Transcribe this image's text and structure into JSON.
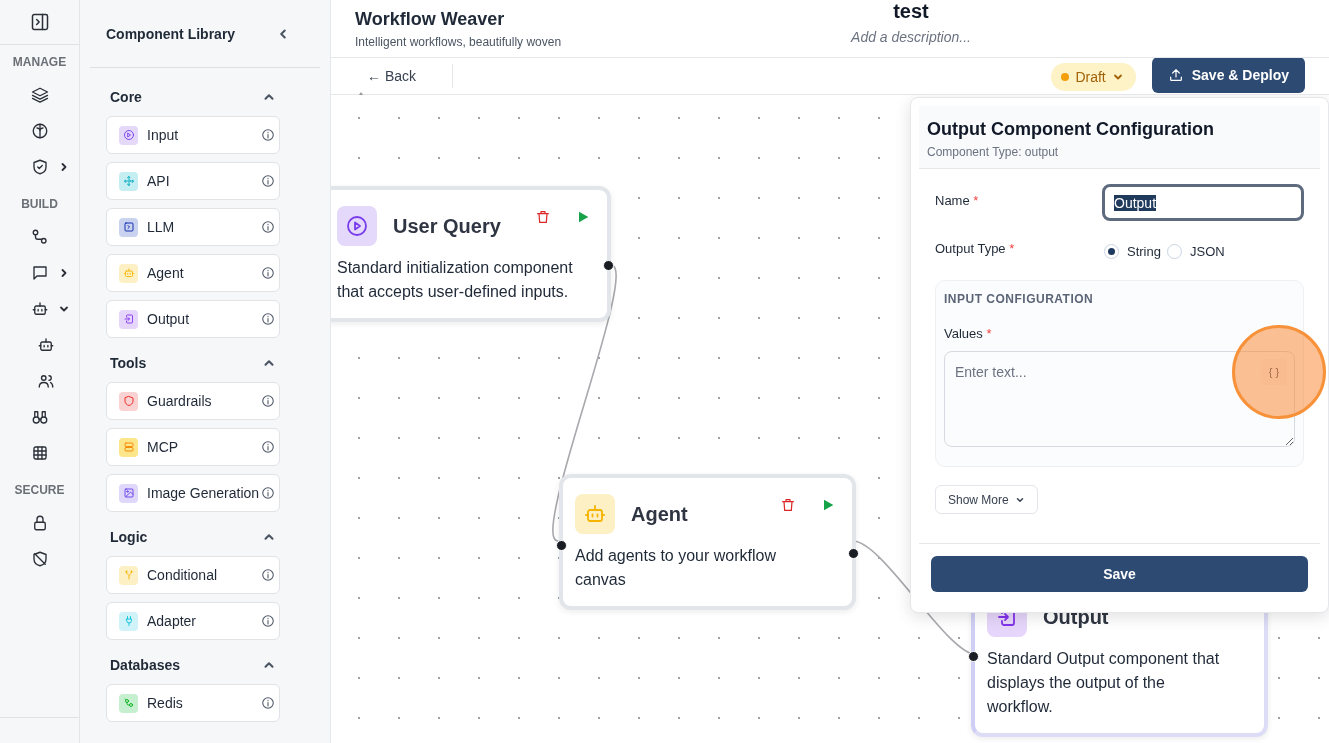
{
  "rail": {
    "sections": [
      {
        "label": "MANAGE",
        "items": [
          {
            "kind": "layers"
          },
          {
            "kind": "brain"
          },
          {
            "kind": "shield",
            "expanded": false
          }
        ]
      },
      {
        "label": "BUILD",
        "items": [
          {
            "kind": "flow"
          },
          {
            "kind": "chat",
            "expanded": false
          },
          {
            "kind": "bot",
            "expanded": true,
            "children": [
              {
                "kind": "bot"
              },
              {
                "kind": "users"
              }
            ]
          },
          {
            "kind": "binoculars"
          },
          {
            "kind": "grid"
          }
        ]
      },
      {
        "label": "SECURE",
        "items": [
          {
            "kind": "lock"
          },
          {
            "kind": "shieldoff"
          }
        ]
      }
    ]
  },
  "library": {
    "title": "Component Library",
    "sections": [
      {
        "title": "Core",
        "expanded": true,
        "items": [
          {
            "label": "Input",
            "kind": "play",
            "color": "#e4d8fb"
          },
          {
            "label": "API",
            "kind": "api",
            "color": "#c4eef2"
          },
          {
            "label": "LLM",
            "kind": "terminal",
            "color": "#c9d2ee"
          },
          {
            "label": "Agent",
            "kind": "bot",
            "color": "#fdf0c4"
          },
          {
            "label": "Output",
            "kind": "output",
            "color": "#e6d6fb"
          }
        ]
      },
      {
        "title": "Tools",
        "expanded": true,
        "items": [
          {
            "label": "Guardrails",
            "kind": "guard",
            "color": "#fbd2d2"
          },
          {
            "label": "MCP",
            "kind": "db",
            "color": "#fde68a"
          },
          {
            "label": "Image Generation",
            "kind": "image",
            "color": "#e0d8fb"
          }
        ]
      },
      {
        "title": "Logic",
        "expanded": true,
        "items": [
          {
            "label": "Conditional",
            "kind": "branch",
            "color": "#fdf0c4"
          },
          {
            "label": "Adapter",
            "kind": "plug",
            "color": "#cff3f8"
          }
        ]
      },
      {
        "title": "Databases",
        "expanded": true,
        "items": [
          {
            "label": "Redis",
            "kind": "redis",
            "color": "#c6efd0"
          }
        ]
      }
    ]
  },
  "header": {
    "app_title": "Workflow Weaver",
    "tagline": "Intelligent workflows, beautifully woven",
    "workflow_name": "test",
    "description_placeholder": "Add a description..."
  },
  "toolbar": {
    "back": "← Back",
    "status": {
      "label": "Draft",
      "color": "#f59e0b"
    },
    "deploy": "Save & Deploy"
  },
  "nodes": [
    {
      "title": "User Query",
      "description": "Standard initialization component that accepts user-defined inputs.",
      "kind": "play",
      "color": "#e4d8fb",
      "selected": false
    },
    {
      "title": "Agent",
      "description": "Add agents to your workflow canvas",
      "kind": "bot",
      "color": "#fdf0c4",
      "selected": false
    },
    {
      "title": "Output",
      "description": "Standard Output component that displays the output of the workflow.",
      "kind": "output",
      "color": "#e6d6fb",
      "selected": true
    }
  ],
  "config": {
    "title": "Output Component Configuration",
    "subtitle": "Component Type: output",
    "name": {
      "label": "Name",
      "required_mark": "*",
      "value": "Output"
    },
    "output_type": {
      "label": "Output Type",
      "required_mark": "*",
      "options": [
        {
          "label": "String",
          "selected": true
        },
        {
          "label": "JSON",
          "selected": false
        }
      ]
    },
    "input_configuration": {
      "heading": "INPUT CONFIGURATION",
      "label": "Values",
      "required_mark": "*",
      "placeholder": "Enter text...",
      "variable_button": "{ }"
    },
    "show_more": "Show More",
    "save": "Save"
  }
}
